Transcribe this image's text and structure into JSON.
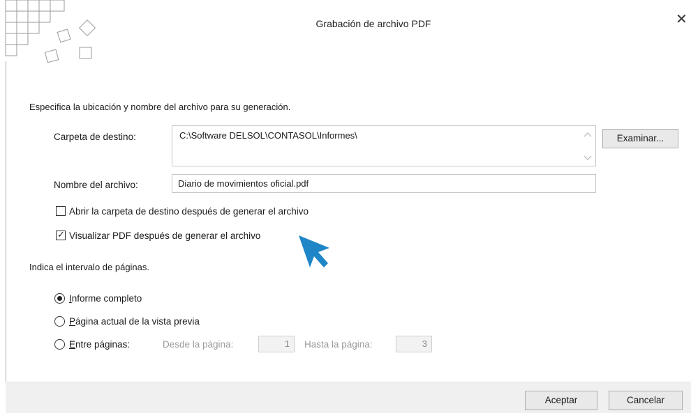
{
  "window": {
    "title": "Grabación de archivo PDF",
    "close_glyph": "✕"
  },
  "location_section": {
    "heading": "Especifica la ubicación y nombre del archivo para su generación.",
    "folder_label": "Carpeta de destino:",
    "folder_value": "C:\\Software DELSOL\\CONTASOL\\Informes\\",
    "browse_button": "Examinar...",
    "filename_label": "Nombre del archivo:",
    "filename_value": "Diario de movimientos oficial.pdf",
    "open_folder_checkbox": {
      "label": "Abrir la carpeta de destino después de generar el archivo",
      "checked": false
    },
    "view_pdf_checkbox": {
      "label": "Visualizar PDF después de generar el archivo",
      "checked": true
    }
  },
  "range_section": {
    "heading": "Indica el intervalo de páginas.",
    "options": [
      {
        "label": "Informe completo",
        "selected": true
      },
      {
        "label": "Página actual de la vista previa",
        "selected": false
      },
      {
        "label": "Entre páginas:",
        "selected": false
      }
    ],
    "from_label": "Desde la página:",
    "from_value": "1",
    "to_label": "Hasta la página:",
    "to_value": "3"
  },
  "footer": {
    "accept_button": "Aceptar",
    "cancel_button": "Cancelar"
  },
  "colors": {
    "pointer_accent": "#1e86c7",
    "footer_bg": "#f0f0f0",
    "button_bg": "#e9e9e9"
  }
}
